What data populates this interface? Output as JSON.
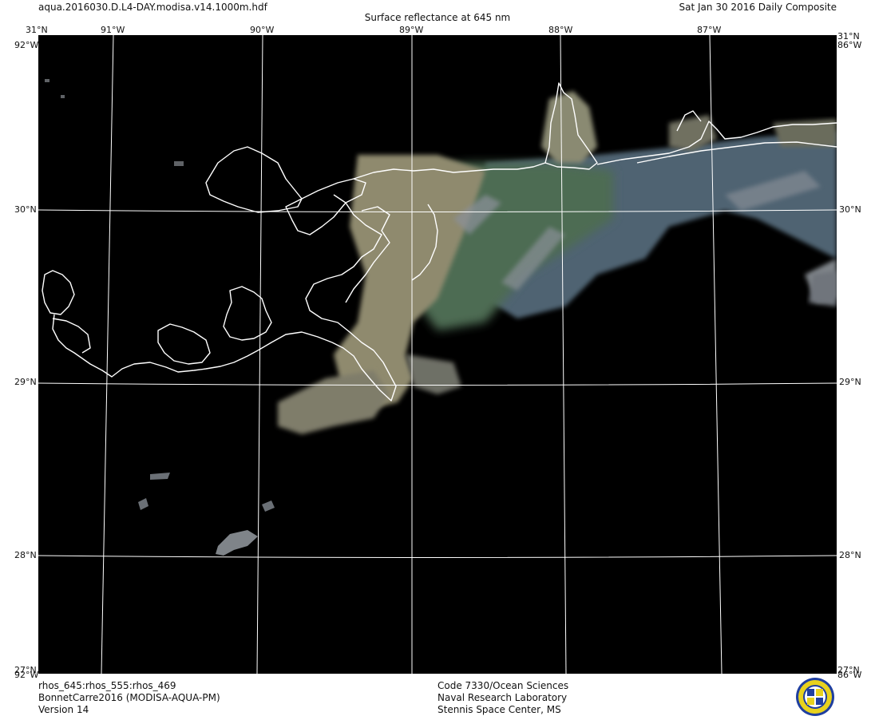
{
  "header": {
    "filename": "aqua.2016030.D.L4-DAY.modisa.v14.1000m.hdf",
    "title": "Surface reflectance at 645 nm",
    "date": "Sat Jan 30 2016 Daily Composite"
  },
  "map": {
    "lon_labels": [
      "91°W",
      "90°W",
      "89°W",
      "88°W",
      "87°W"
    ],
    "lat_labels": [
      "30°N",
      "29°N",
      "28°N"
    ],
    "corner_top": "31°N",
    "corner_lon": "92°W",
    "corner_lon_right": "86°W",
    "corner_bottom": "27°N",
    "colors": {
      "background": "#000000",
      "grid": "#ffffff",
      "coastline": "#ffffff",
      "plume_tan": "#8f8a6e",
      "plume_green": "#4d6c53",
      "plume_blue": "#4f6472",
      "cloud_gray": "#7f8489"
    }
  },
  "footer": {
    "left": [
      "rhos_645:rhos_555:rhos_469",
      "BonnetCarre2016 (MODISA-AQUA-PM)",
      "Version 14"
    ],
    "center": [
      "Code 7330/Ocean Sciences",
      "Naval Research Laboratory",
      "Stennis Space Center, MS"
    ],
    "logo_icon": "nrl-seal-icon"
  }
}
